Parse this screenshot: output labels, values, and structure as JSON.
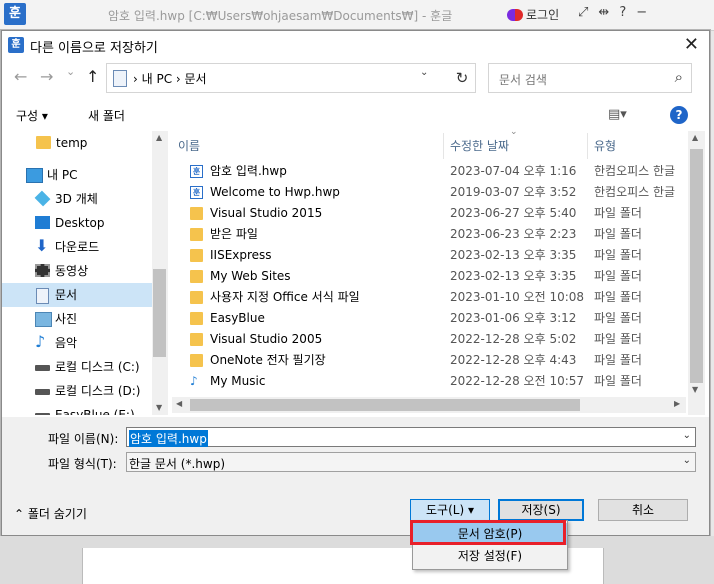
{
  "app": {
    "logo": "훈",
    "title": "암호 입력.hwp [C:₩Users₩ohjaesam₩Documents₩] - 훈글",
    "login": "로그인",
    "icons": [
      "expand-icon",
      "pin-icon",
      "help-icon",
      "minimize-icon"
    ]
  },
  "dialog": {
    "logo": "훈",
    "title": "다른 이름으로 저장하기",
    "close": "✕"
  },
  "nav": {
    "back": "←",
    "forward": "→",
    "dropdown": "⌄",
    "up": "↑",
    "address": "› 내 PC › 문서",
    "address_dropdown": "⌄",
    "refresh": "↻",
    "search_placeholder": "문서 검색",
    "search_icon": "⌕"
  },
  "toolbar": {
    "organize": "구성 ▾",
    "new_folder": "새 폴더",
    "view": "▤▾",
    "help": "?"
  },
  "sidebar": {
    "items": [
      {
        "label": "temp",
        "icon": "folder-icon"
      },
      {
        "label": "내 PC",
        "icon": "pc-icon"
      },
      {
        "label": "3D 개체",
        "icon": "3d-objects-icon"
      },
      {
        "label": "Desktop",
        "icon": "desktop-icon"
      },
      {
        "label": "다운로드",
        "icon": "download-icon"
      },
      {
        "label": "동영상",
        "icon": "video-icon"
      },
      {
        "label": "문서",
        "icon": "documents-icon",
        "selected": true
      },
      {
        "label": "사진",
        "icon": "pictures-icon"
      },
      {
        "label": "음악",
        "icon": "music-icon"
      },
      {
        "label": "로컬 디스크 (C:)",
        "icon": "drive-icon"
      },
      {
        "label": "로컬 디스크 (D:)",
        "icon": "drive-icon"
      },
      {
        "label": "EasyBlue (E:)",
        "icon": "drive-icon"
      }
    ]
  },
  "list": {
    "columns": [
      "이름",
      "수정한 날짜",
      "유형"
    ],
    "rows": [
      {
        "name": "암호 입력.hwp",
        "date": "2023-07-04 오후 1:16",
        "type": "한컴오피스 한글",
        "icon": "hwp"
      },
      {
        "name": "Welcome to Hwp.hwp",
        "date": "2019-03-07 오후 3:52",
        "type": "한컴오피스 한글",
        "icon": "hwp"
      },
      {
        "name": "Visual Studio 2015",
        "date": "2023-06-27 오후 5:40",
        "type": "파일 폴더",
        "icon": "folder"
      },
      {
        "name": "받은 파일",
        "date": "2023-06-23 오후 2:23",
        "type": "파일 폴더",
        "icon": "folder"
      },
      {
        "name": "IISExpress",
        "date": "2023-02-13 오후 3:35",
        "type": "파일 폴더",
        "icon": "folder"
      },
      {
        "name": "My Web Sites",
        "date": "2023-02-13 오후 3:35",
        "type": "파일 폴더",
        "icon": "folder"
      },
      {
        "name": "사용자 지정 Office 서식 파일",
        "date": "2023-01-10 오전 10:08",
        "type": "파일 폴더",
        "icon": "folder"
      },
      {
        "name": "EasyBlue",
        "date": "2023-01-06 오후 3:12",
        "type": "파일 폴더",
        "icon": "folder"
      },
      {
        "name": "Visual Studio 2005",
        "date": "2022-12-28 오후 5:02",
        "type": "파일 폴더",
        "icon": "folder"
      },
      {
        "name": "OneNote 전자 필기장",
        "date": "2022-12-28 오후 4:43",
        "type": "파일 폴더",
        "icon": "folder"
      },
      {
        "name": "My Music",
        "date": "2022-12-28 오전 10:57",
        "type": "파일 폴더",
        "icon": "music"
      }
    ]
  },
  "form": {
    "filename_label": "파일 이름(N):",
    "filename_value": "암호 입력.hwp",
    "filetype_label": "파일 형식(T):",
    "filetype_value": "한글 문서 (*.hwp)",
    "folder_toggle": "⌃  폴더 숨기기",
    "tools_button": "도구(L)   ▾",
    "save_button": "저장(S)",
    "cancel_button": "취소"
  },
  "menu": {
    "items": [
      "문서 암호(P)",
      "저장 설정(F)"
    ]
  },
  "colors": {
    "accent": "#0078d7",
    "highlight_box": "#e8202a",
    "selected_row": "#cce4f7"
  }
}
